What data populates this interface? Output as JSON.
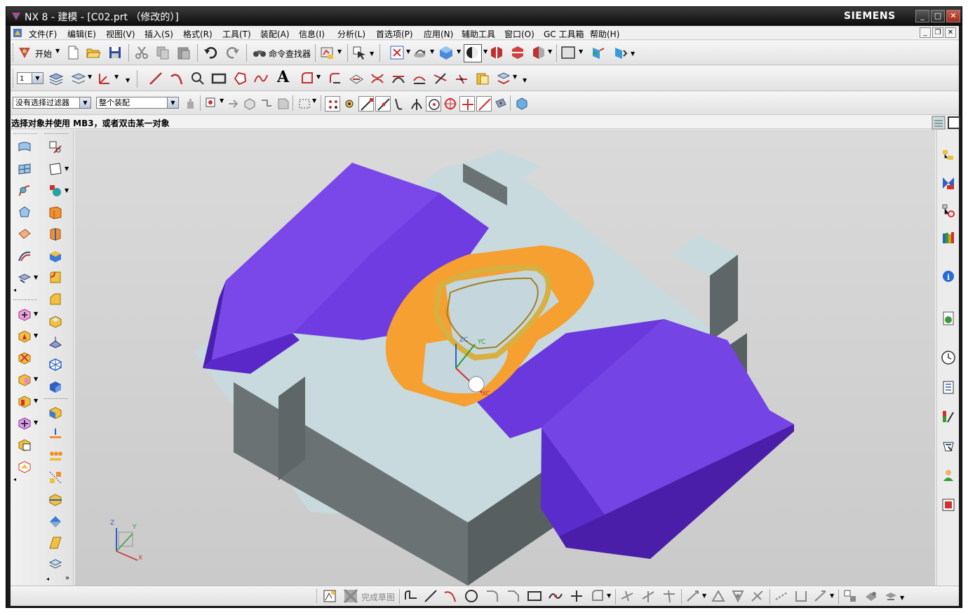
{
  "window": {
    "title": "NX 8 - 建模 - [C02.prt （修改的）]",
    "brand": "SIEMENS",
    "minimize": "_",
    "maximize": "□",
    "close": "✕"
  },
  "menubar": {
    "items": [
      "文件(F)",
      "编辑(E)",
      "视图(V)",
      "插入(S)",
      "格式(R)",
      "工具(T)",
      "装配(A)",
      "信息(I)",
      "分析(L)",
      "首选项(P)",
      "应用(N)",
      "辅助工具",
      "窗口(O)",
      "GC 工具箱",
      "帮助(H)"
    ]
  },
  "toolbar1": {
    "start_label": "开始",
    "command_finder_label": "命令查找器"
  },
  "selection_bar": {
    "filter_value": "没有选择过滤器",
    "scope_value": "整个装配"
  },
  "status": {
    "prompt": "选择对象并使用 MB3，或者双击某一对象"
  },
  "sketch_bar": {
    "finish_label": "完成草图"
  },
  "viewport": {
    "wcs_labels": [
      "ZC",
      "YC",
      "XC"
    ],
    "triad_labels": [
      "Z",
      "Y",
      "X"
    ],
    "colors": {
      "background": "#d0d0d0",
      "purple": "#7a3fe0",
      "grey_face": "#c5d7dd",
      "grey_side": "#6e7779",
      "orange": "#f5a030",
      "gold": "#d8b040"
    }
  }
}
